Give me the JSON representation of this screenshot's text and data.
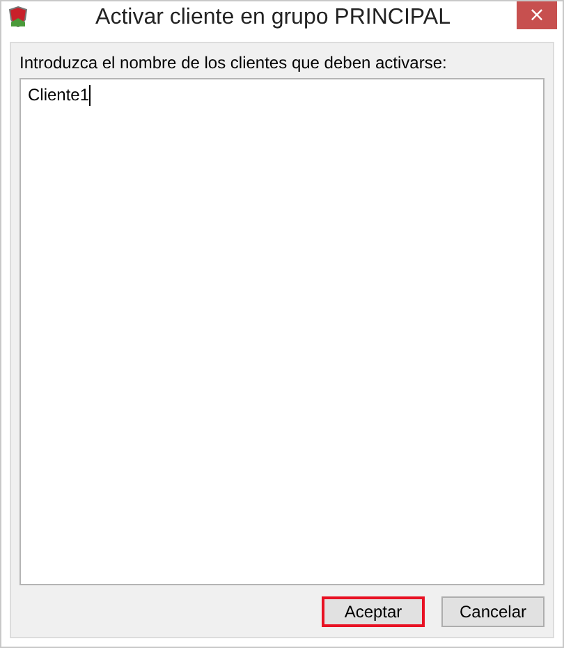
{
  "window": {
    "title": "Activar cliente en grupo PRINCIPAL",
    "close": "×"
  },
  "prompt": "Introduzca el nombre de los clientes que deben activarse:",
  "input": {
    "value": "Cliente1"
  },
  "buttons": [
    {
      "label": "Aceptar",
      "focused": true
    },
    {
      "label": "Cancelar",
      "focused": false
    }
  ]
}
